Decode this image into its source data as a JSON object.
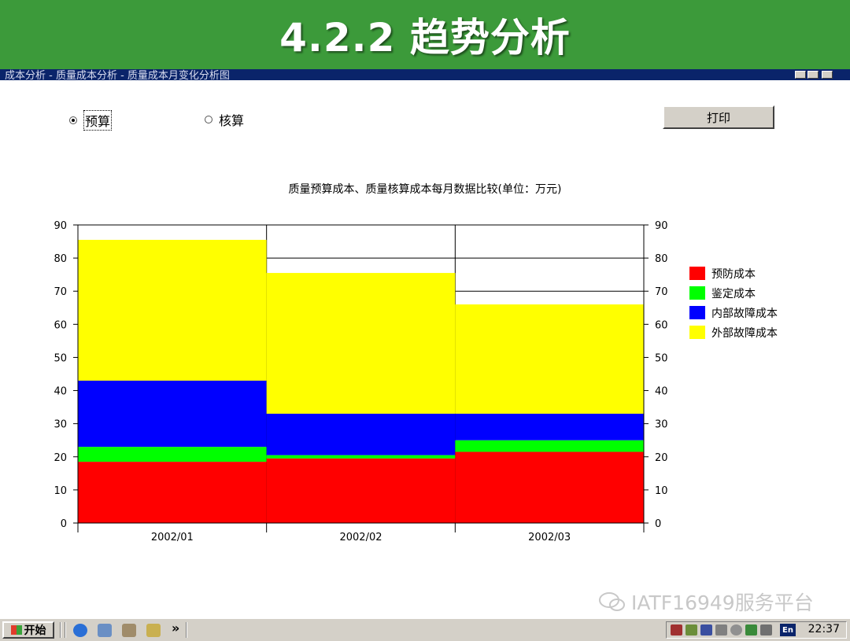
{
  "banner": {
    "title": "4.2.2 趋势分析"
  },
  "window": {
    "title": "成本分析 - 质量成本分析 - 质量成本月变化分析图"
  },
  "controls": {
    "radio_budget": "预算",
    "radio_actual": "核算",
    "selected": "预算",
    "print_label": "打印"
  },
  "colors": {
    "banner": "#3c9a3a",
    "titlebar": "#0a246a",
    "prevention": "#ff0000",
    "appraisal": "#00ff00",
    "internal_failure": "#0000ff",
    "external_failure": "#ffff00"
  },
  "chart_data": {
    "type": "bar",
    "stacked": true,
    "title": "质量预算成本、质量核算成本每月数据比较(单位：万元)",
    "xlabel": "",
    "ylabel": "",
    "categories": [
      "2002/01",
      "2002/02",
      "2002/03"
    ],
    "ylim": [
      0,
      90
    ],
    "yticks": [
      0,
      10,
      20,
      30,
      40,
      50,
      60,
      70,
      80,
      90
    ],
    "grid": true,
    "dual_y_axis": true,
    "legend_position": "right",
    "series": [
      {
        "name": "预防成本",
        "color": "#ff0000",
        "values": [
          18.5,
          19.5,
          21.5
        ]
      },
      {
        "name": "鉴定成本",
        "color": "#00ff00",
        "values": [
          4.5,
          1,
          3.5
        ]
      },
      {
        "name": "内部故障成本",
        "color": "#0000ff",
        "values": [
          20,
          12.5,
          8
        ]
      },
      {
        "name": "外部故障成本",
        "color": "#ffff00",
        "values": [
          42.5,
          42.5,
          33
        ]
      }
    ]
  },
  "watermark": {
    "text": "IATF16949服务平台"
  },
  "taskbar": {
    "start_label": "开始",
    "overflow_label": "»",
    "ime_label": "En",
    "clock": "22:37"
  }
}
